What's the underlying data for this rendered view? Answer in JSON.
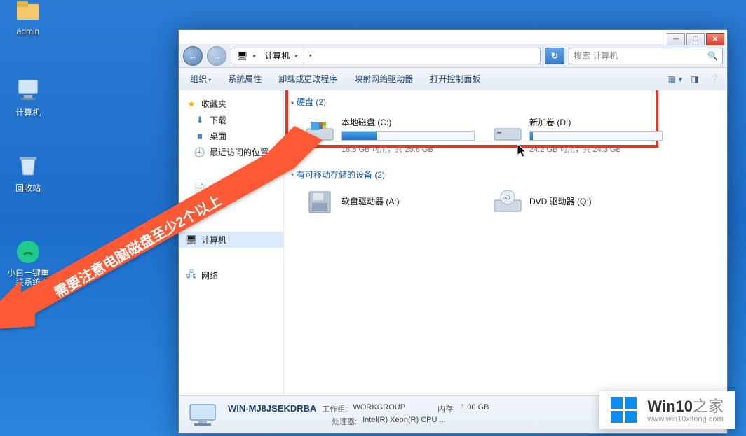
{
  "desktop": {
    "icons": [
      {
        "label": "admin",
        "key": "admin"
      },
      {
        "label": "计算机",
        "key": "computer"
      },
      {
        "label": "回收站",
        "key": "recycle"
      },
      {
        "label": "小白一键重装系统",
        "key": "xiaobai"
      }
    ]
  },
  "window": {
    "address_root": "计算机",
    "search_placeholder": "搜索 计算机",
    "toolbar": {
      "organize": "组织",
      "sysprop": "系统属性",
      "uninstall": "卸载或更改程序",
      "mapnet": "映射网络驱动器",
      "ctrlpanel": "打开控制面板"
    },
    "sidebar": {
      "favorites": "收藏夹",
      "downloads": "下载",
      "desktop": "桌面",
      "recent": "最近访问的位置",
      "documents": "文档",
      "music": "音乐",
      "computer": "计算机",
      "network": "网络"
    },
    "sections": {
      "hdd_header": "硬盘 (2)",
      "removable_header": "有可移动存储的设备 (2)"
    },
    "drives": {
      "c": {
        "name": "本地磁盘 (C:)",
        "sub": "18.8 GB 可用，共 25.6 GB",
        "fill_pct": 26
      },
      "d": {
        "name": "新加卷 (D:)",
        "sub": "24.2 GB 可用，共 24.3 GB",
        "fill_pct": 2
      },
      "a": {
        "name": "软盘驱动器 (A:)"
      },
      "q": {
        "name": "DVD 驱动器 (Q:)"
      }
    },
    "details": {
      "computer_name": "WIN-MJ8JSEKDRBA",
      "workgroup_label": "工作组:",
      "workgroup": "WORKGROUP",
      "mem_label": "内存:",
      "mem": "1.00 GB",
      "cpu_label": "处理器:",
      "cpu": "Intel(R) Xeon(R) CPU ..."
    }
  },
  "annotation": {
    "text": "需要注意电脑磁盘至少2个以上"
  },
  "watermark": {
    "brand_bold": "Win10",
    "brand_light": "之家",
    "url": "www.win10xitong.com"
  }
}
